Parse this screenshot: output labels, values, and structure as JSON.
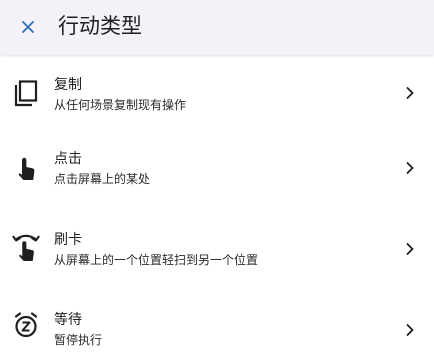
{
  "header": {
    "close_icon": "close-icon",
    "title": "行动类型"
  },
  "colors": {
    "header_background": "#f4f2f8",
    "accent": "#2f6fb5",
    "text": "#1f1f1f"
  },
  "items": [
    {
      "icon": "copy-icon",
      "title": "复制",
      "subtitle": "从任何场景复制现有操作"
    },
    {
      "icon": "tap-icon",
      "title": "点击",
      "subtitle": "点击屏幕上的某处"
    },
    {
      "icon": "swipe-icon",
      "title": "刷卡",
      "subtitle": "从屏幕上的一个位置轻扫到另一个位置"
    },
    {
      "icon": "snooze-icon",
      "title": "等待",
      "subtitle": "暂停执行"
    }
  ]
}
